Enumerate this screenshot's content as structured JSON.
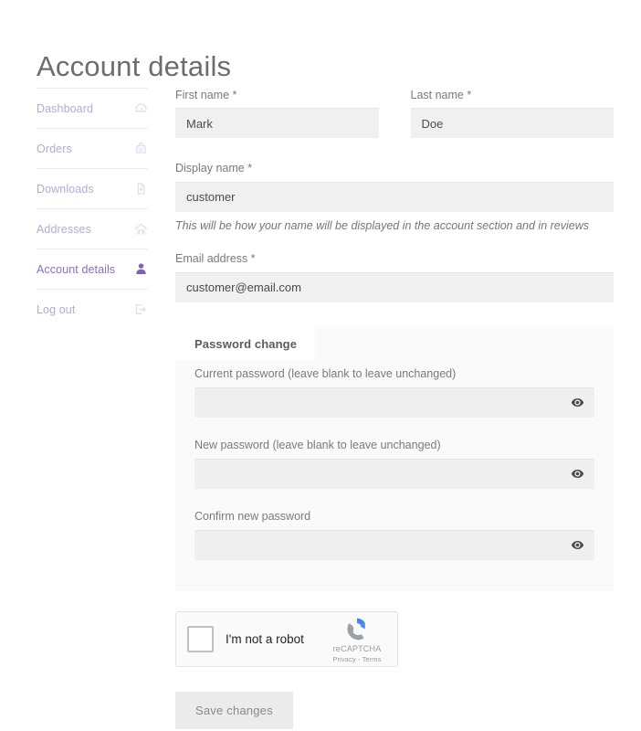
{
  "page": {
    "title": "Account details"
  },
  "sidebar": {
    "items": [
      {
        "label": "Dashboard",
        "icon": "dashboard-gauge-icon",
        "active": false
      },
      {
        "label": "Orders",
        "icon": "shopping-bag-icon",
        "active": false
      },
      {
        "label": "Downloads",
        "icon": "download-file-icon",
        "active": false
      },
      {
        "label": "Addresses",
        "icon": "home-icon",
        "active": false
      },
      {
        "label": "Account details",
        "icon": "user-icon",
        "active": true
      },
      {
        "label": "Log out",
        "icon": "sign-out-icon",
        "active": false
      }
    ],
    "colors": {
      "link": "#b7a9d4",
      "link_active": "#8a6fc0",
      "icon": "#e3dced",
      "icon_active": "#7e61ba",
      "divider": "#eceaef"
    }
  },
  "form": {
    "first_name": {
      "label": "First name *",
      "value": "Mark",
      "placeholder": ""
    },
    "last_name": {
      "label": "Last name *",
      "value": "Doe",
      "placeholder": ""
    },
    "display_name": {
      "label": "Display name *",
      "value": "customer",
      "placeholder": "",
      "help": "This will be how your name will be displayed in the account section and in reviews"
    },
    "email": {
      "label": "Email address *",
      "value": "customer@email.com",
      "placeholder": ""
    },
    "password_change": {
      "legend": "Password change",
      "fields": [
        {
          "label": "Current password (leave blank to leave unchanged)",
          "value": "",
          "placeholder": "",
          "toggle_icon": "eye-icon"
        },
        {
          "label": "New password (leave blank to leave unchanged)",
          "value": "",
          "placeholder": "",
          "toggle_icon": "eye-icon"
        },
        {
          "label": "Confirm new password",
          "value": "",
          "placeholder": "",
          "toggle_icon": "eye-icon"
        }
      ]
    },
    "recaptcha": {
      "checkbox_label": "I'm not a robot",
      "brand": "reCAPTCHA",
      "links": "Privacy - Terms",
      "checked": false
    },
    "save_button": "Save changes"
  },
  "colors": {
    "input_background": "#f0f0f0",
    "fieldset_background": "#fafafa",
    "button_background": "#ebebeb",
    "button_text": "#8a8a8a",
    "label_text": "#7a7a7a",
    "title_text": "#6d6d6d"
  }
}
